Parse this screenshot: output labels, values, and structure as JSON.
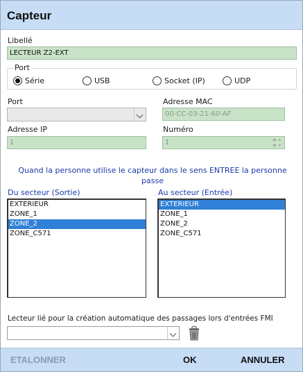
{
  "dialog": {
    "title": "Capteur"
  },
  "libelle": {
    "label": "Libellé",
    "value": "LECTEUR Z2-EXT"
  },
  "port_group": {
    "legend": "Port",
    "options": [
      {
        "label": "Série",
        "checked": true
      },
      {
        "label": "USB",
        "checked": false
      },
      {
        "label": "Socket (IP)",
        "checked": false
      },
      {
        "label": "UDP",
        "checked": false
      }
    ]
  },
  "port": {
    "label": "Port",
    "value": ""
  },
  "mac": {
    "label": "Adresse MAC",
    "value": "00-CC-03-21-60-AF"
  },
  "ip": {
    "label": "Adresse IP",
    "value": "1"
  },
  "numero": {
    "label": "Numéro",
    "value": "1"
  },
  "message": "Quand la personne utilise le capteur dans le sens ENTREE la personne passe",
  "from_sector": {
    "label": "Du secteur (Sortie)",
    "items": [
      "EXTERIEUR",
      "ZONE_1",
      "ZONE_2",
      "ZONE_C571"
    ],
    "selected_index": 2
  },
  "to_sector": {
    "label": "Au secteur (Entrée)",
    "items": [
      "EXTERIEUR",
      "ZONE_1",
      "ZONE_2",
      "ZONE_C571"
    ],
    "selected_index": 0
  },
  "linked_reader": {
    "label": "Lecteur lié pour la création automatique des passages lors d'entrées FMI",
    "value": ""
  },
  "footer": {
    "calibrate": "ETALONNER",
    "ok": "OK",
    "cancel": "ANNULER"
  },
  "colors": {
    "header": "#c7dcf5",
    "field_green": "#c9e3c9",
    "selection": "#2f80d6",
    "message": "#1a3aa8"
  }
}
